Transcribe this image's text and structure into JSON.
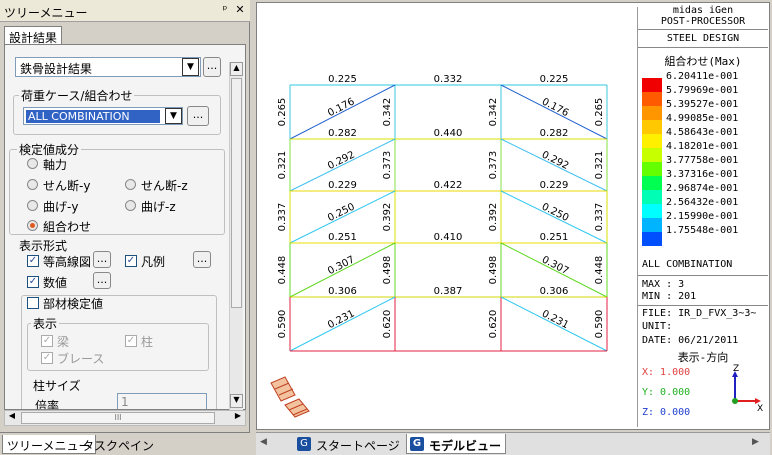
{
  "tree_panel": {
    "title": "ツリーメニュー",
    "pin": "ᵖ",
    "close": "✕",
    "tab": "設計結果",
    "result_type": "鉄骨設計結果",
    "load_case_group": "荷重ケース/組合わせ",
    "load_case": "ALL COMBINATION",
    "check_group": "検定値成分",
    "radios": [
      "軸力",
      "せん断-y",
      "せん断-z",
      "曲げ-y",
      "曲げ-z",
      "組合わせ"
    ],
    "display_group": "表示形式",
    "display_opts": [
      "等高線図",
      "凡例",
      "数値"
    ],
    "member_check": "部材検定値",
    "disp_group": "表示",
    "disp_items": [
      "梁",
      "柱",
      "ブレース"
    ],
    "col_size_group": "柱サイズ",
    "scale_label": "倍率",
    "scale_value": "1",
    "more": "...",
    "scroll_mark": "III"
  },
  "bottom_tabs": [
    "ツリーメニュー",
    "タスクペイン"
  ],
  "view_tabs": [
    "スタートページ",
    "モデルビュー"
  ],
  "colors": {
    "legend": [
      "#f00000",
      "#ff5a00",
      "#ff9600",
      "#ffc800",
      "#fff000",
      "#c8ff00",
      "#64ff00",
      "#00ff50",
      "#00ffb4",
      "#00ffff",
      "#00b4ff",
      "#0050ff"
    ]
  },
  "legend": {
    "header1": "midas iGen",
    "header2": "POST-PROCESSOR",
    "header3": "STEEL DESIGN",
    "combo_title": "組合わせ(Max)",
    "values": [
      "6.20411e-001",
      "5.79969e-001",
      "5.39527e-001",
      "4.99085e-001",
      "4.58643e-001",
      "4.18201e-001",
      "3.77758e-001",
      "3.37316e-001",
      "2.96874e-001",
      "2.56432e-001",
      "2.15990e-001",
      "1.75548e-001"
    ],
    "load": "ALL COMBINATION",
    "max": "MAX : 3",
    "min": "MIN : 201",
    "file": "FILE: IR_D_FVX_3~3~",
    "unit": "UNIT:",
    "date": "DATE: 06/21/2011",
    "direction": "表示-方向",
    "x": "X: 1.000",
    "y": "Y: 0.000",
    "z": "Z: 0.000"
  },
  "model": {
    "beams_top": [
      [
        "0.225",
        "0.332",
        "0.225"
      ],
      [
        "0.282",
        "0.440",
        "0.282"
      ],
      [
        "0.229",
        "0.422",
        "0.229"
      ],
      [
        "0.251",
        "0.410",
        "0.251"
      ],
      [
        "0.306",
        "0.387",
        "0.306"
      ]
    ],
    "columns_outer": [
      "0.265",
      "0.321",
      "0.337",
      "0.448",
      "0.590"
    ],
    "columns_inner": [
      "0.342",
      "0.373",
      "0.392",
      "0.498",
      "0.620"
    ],
    "braces": [
      "0.176",
      "0.292",
      "0.250",
      "0.307",
      "0.231"
    ]
  }
}
